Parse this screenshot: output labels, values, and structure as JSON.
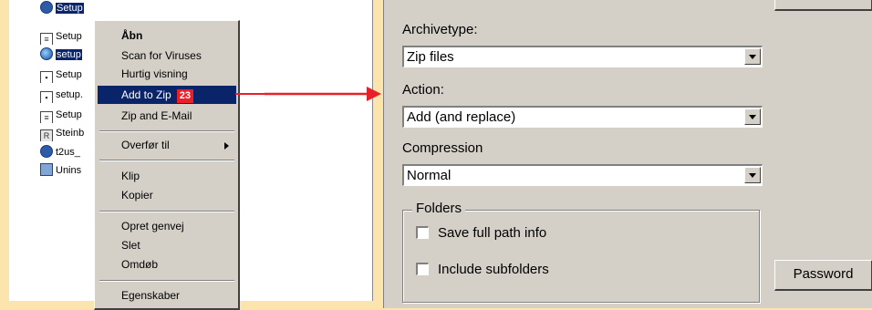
{
  "explorer": {
    "files": [
      {
        "label": "Setup",
        "icon": "setup-icon",
        "selected": true
      },
      {
        "label": "Setup",
        "icon": "document-icon"
      },
      {
        "label": "setup",
        "icon": "globe-icon",
        "selected": true
      },
      {
        "label": "Setup",
        "icon": "application-icon"
      },
      {
        "label": "setup.",
        "icon": "application-icon"
      },
      {
        "label": "Setup",
        "icon": "text-file-icon"
      },
      {
        "label": "Steinb",
        "icon": "registry-icon"
      },
      {
        "label": "t2us_",
        "icon": "installer-icon"
      },
      {
        "label": "Unins",
        "icon": "uninstall-icon"
      }
    ]
  },
  "context_menu": {
    "items": [
      {
        "label": "Åbn",
        "bold": true
      },
      {
        "label": "Scan for Viruses"
      },
      {
        "label": "Hurtig visning"
      },
      {
        "label": "Add to Zip",
        "highlighted": true,
        "badge": "23"
      },
      {
        "label": "Zip and E-Mail"
      },
      {
        "label": "Overfør til",
        "submenu": true
      },
      {
        "label": "Klip"
      },
      {
        "label": "Kopier"
      },
      {
        "label": "Opret genvej"
      },
      {
        "label": "Slet"
      },
      {
        "label": "Omdøb"
      },
      {
        "label": "Egenskaber"
      }
    ]
  },
  "dialog": {
    "archivetype_label": "Archivetype:",
    "archivetype_value": "Zip files",
    "action_label": "Action:",
    "action_value": "Add (and replace)",
    "compression_label": "Compression",
    "compression_value": "Normal",
    "folders_title": "Folders",
    "save_full_path_label": "Save full path info",
    "include_subfolders_label": "Include subfolders",
    "password_button": "Password"
  },
  "colors": {
    "page_background": "#fbe5ad",
    "highlight": "#0a246a",
    "badge": "#e8202a",
    "arrow": "#e8202a",
    "dialog_face": "#d4d0c8"
  }
}
